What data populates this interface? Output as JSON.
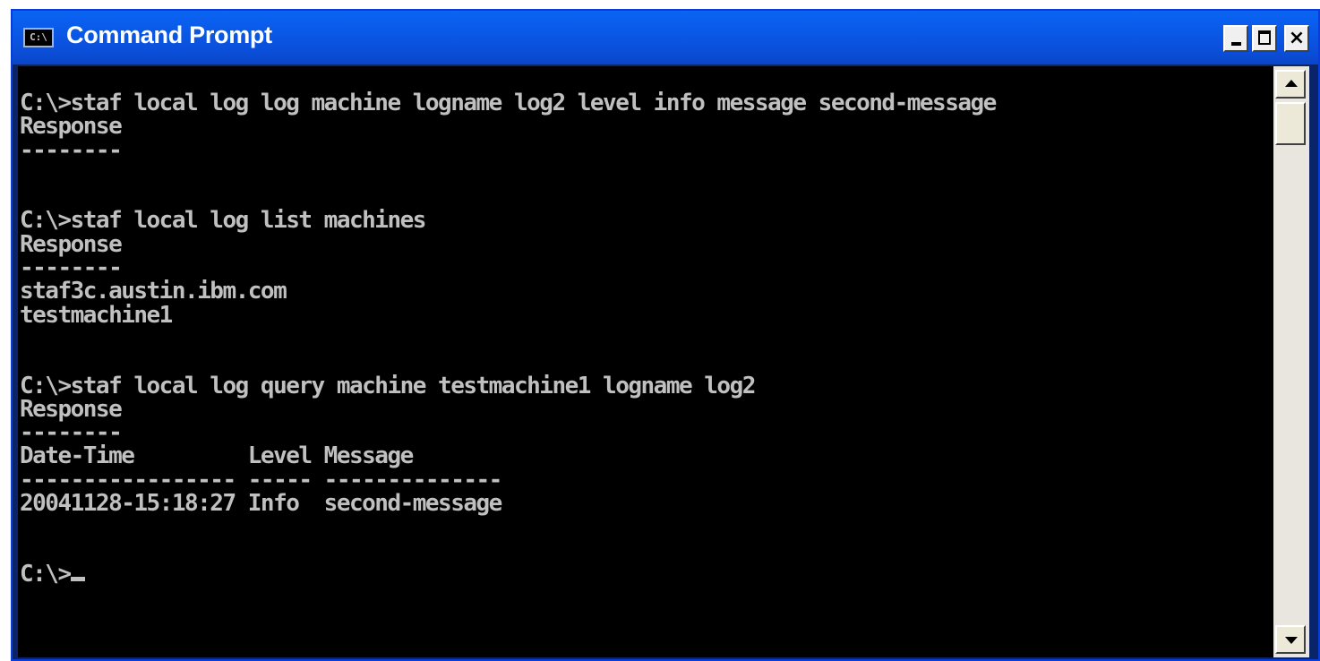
{
  "window": {
    "title": "Command Prompt",
    "icon_label": "C:\\"
  },
  "controls": {
    "minimize": "minimize",
    "maximize": "maximize",
    "close": "×"
  },
  "console": {
    "text": "C:\\>staf local log log machine logname log2 level info message second-message\nResponse\n--------\n\n\nC:\\>staf local log list machines\nResponse\n--------\nstaf3c.austin.ibm.com\ntestmachine1\n\n\nC:\\>staf local log query machine testmachine1 logname log2\nResponse\n--------\nDate-Time         Level Message\n----------------- ----- --------------\n20041128-15:18:27 Info  second-message\n\n\n",
    "prompt": "C:\\>"
  },
  "colors": {
    "titlebar": "#0a5ae8",
    "console_bg": "#000000",
    "console_fg": "#c0c0c0"
  }
}
